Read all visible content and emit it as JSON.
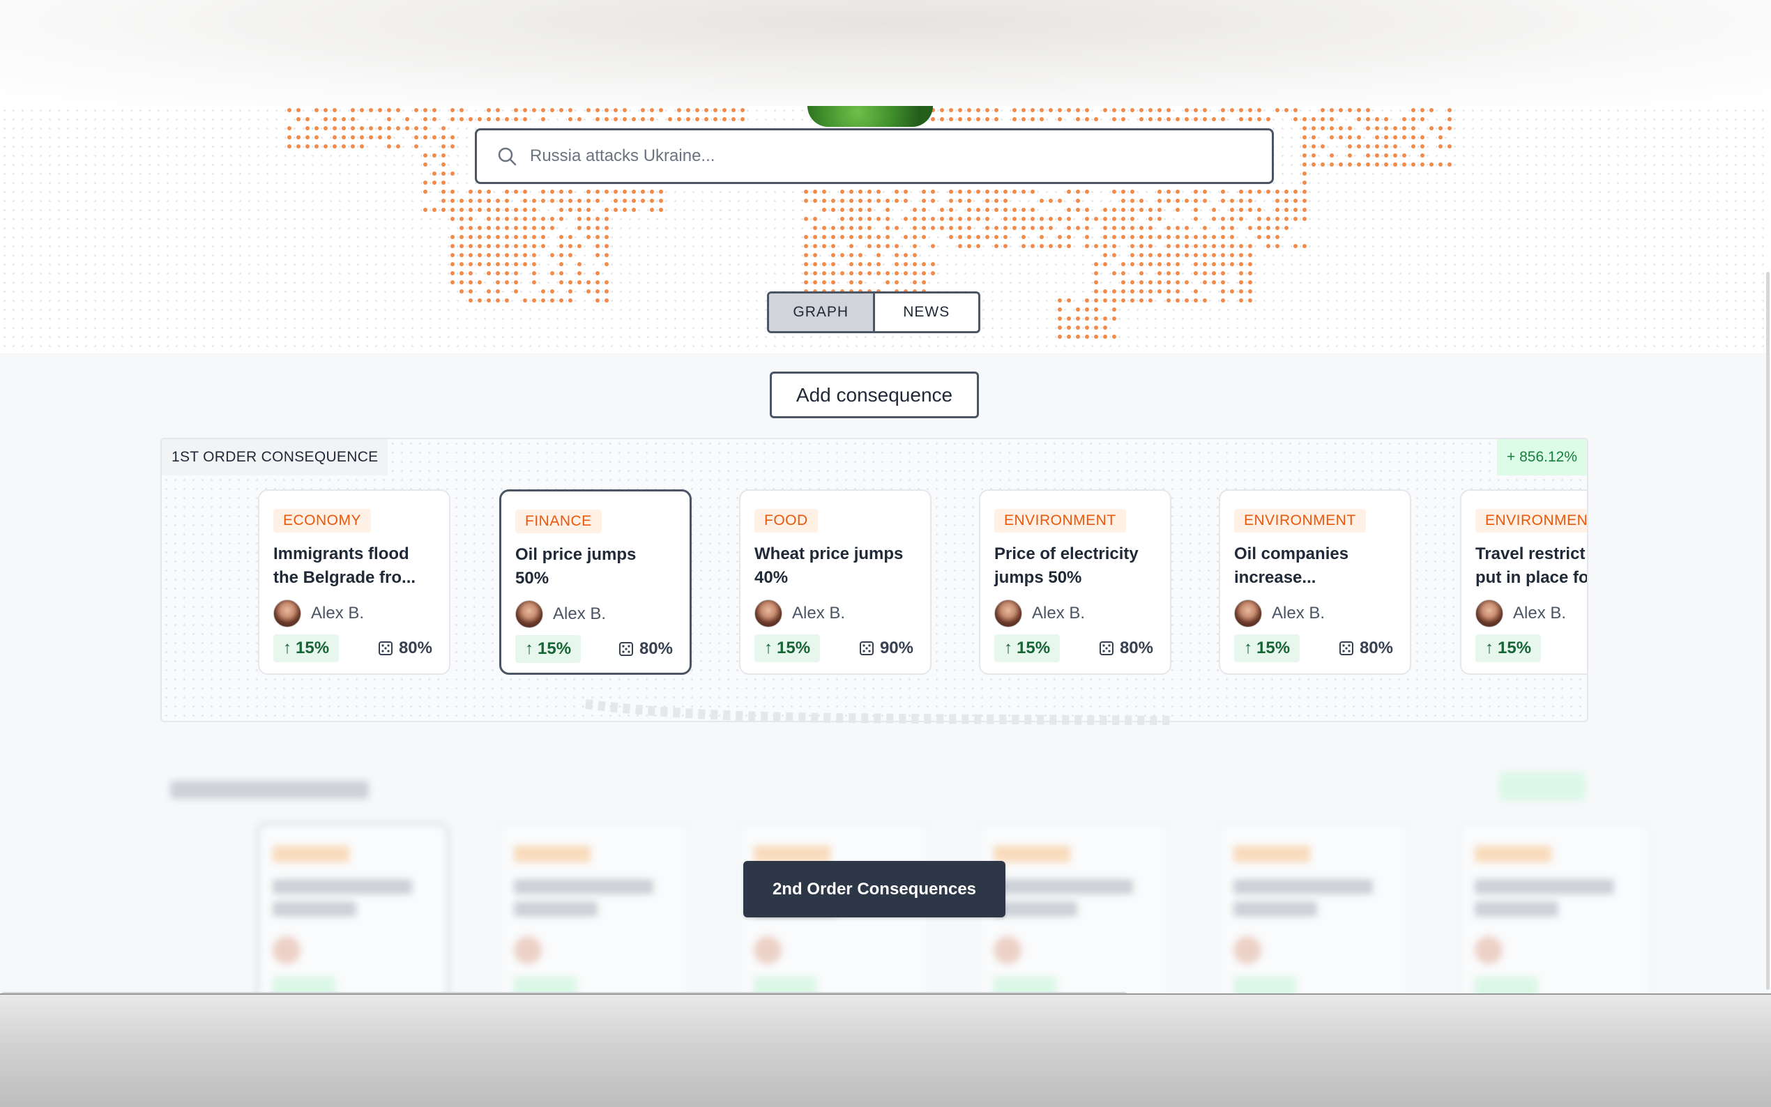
{
  "search": {
    "placeholder": "Russia attacks Ukraine..."
  },
  "view_toggle": {
    "options": [
      "GRAPH",
      "NEWS"
    ],
    "selected": "GRAPH"
  },
  "add_consequence_label": "Add consequence",
  "first_order": {
    "title": "1ST ORDER CONSEQUENCE",
    "total_change": "+ 856.12%",
    "cards": [
      {
        "category": "ECONOMY",
        "title": "Immigrants flood\nthe Belgrade fro...",
        "author": "Alex B.",
        "impact": "15%",
        "probability": "80%"
      },
      {
        "category": "FINANCE",
        "title": "Oil price jumps\n50%",
        "author": "Alex B.",
        "impact": "15%",
        "probability": "80%"
      },
      {
        "category": "FOOD",
        "title": "Wheat price jumps\n40%",
        "author": "Alex B.",
        "impact": "15%",
        "probability": "90%"
      },
      {
        "category": "ENVIRONMENT",
        "title": "Price of electricity\njumps 50%",
        "author": "Alex B.",
        "impact": "15%",
        "probability": "80%"
      },
      {
        "category": "ENVIRONMENT",
        "title": "Oil companies\nincrease...",
        "author": "Alex B.",
        "impact": "15%",
        "probability": "80%"
      },
      {
        "category": "ENVIRONMENT",
        "title": "Travel restrict\nput in place fo",
        "author": "Alex B.",
        "impact": "15%",
        "probability": ""
      }
    ]
  },
  "second_order_button_label": "2nd Order Consequences",
  "colors": {
    "accent_orange": "#f28a4a",
    "category_text": "#ea580c",
    "positive_green": "#15803d",
    "button_dark": "#2d3748"
  },
  "icons": {
    "search": "magnifier",
    "impact": "arrow-up",
    "probability": "dice"
  }
}
